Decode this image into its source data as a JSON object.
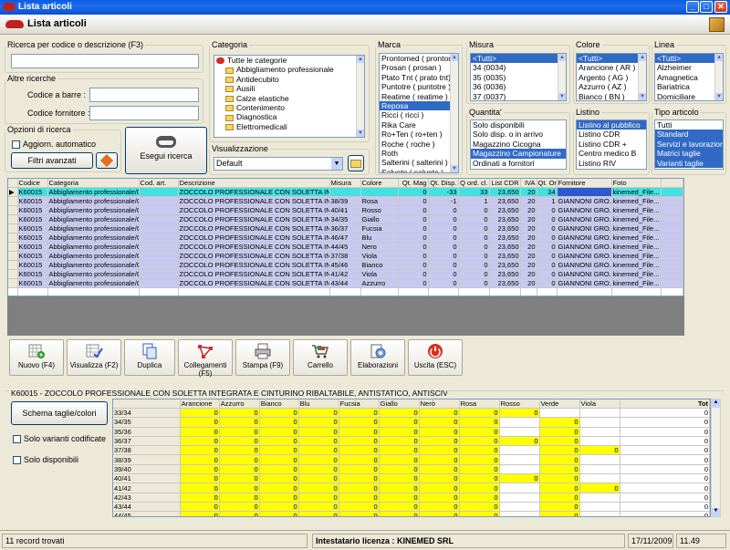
{
  "window": {
    "title": "Lista articoli",
    "header_title": "Lista articoli"
  },
  "search": {
    "legend": "Ricerca per codice o descrizione (F3)",
    "value": ""
  },
  "other_search": {
    "legend": "Altre ricerche",
    "barcode_label": "Codice a barre :",
    "supplier_code_label": "Codice fornitore :",
    "barcode_value": "",
    "supplier_code_value": ""
  },
  "options": {
    "legend": "Opzioni di ricerca",
    "auto_update_label": "Aggiorn. automatico",
    "advanced_filters_label": "Filtri avanzati",
    "execute_label": "Esegui ricerca"
  },
  "categoria": {
    "legend": "Categoria",
    "items": [
      "Tutte le categorie",
      "Abbigliamento professionale",
      "Antidecubito",
      "Ausili",
      "Calze elastiche",
      "Contenimento",
      "Diagnostica",
      "Elettromedicali"
    ]
  },
  "visualizzazione": {
    "legend": "Visualizzazione",
    "value": "Default"
  },
  "marca": {
    "legend": "Marca",
    "items": [
      "Prontomed ( prontom",
      "Prosan ( prosan )",
      "Ptato Tnt ( prato tnt)",
      "Puntotre ( puntotre )",
      "Reatime ( reatime )",
      "Reposa",
      "Ricci ( ricci )",
      "Rika Care",
      "Ro+Ten ( ro+ten )",
      "Roche ( roche )",
      "Roth",
      "Salterini ( salterini )",
      "Salvete ( salvete )"
    ],
    "selected": 5
  },
  "misura": {
    "legend": "Misura",
    "items": [
      "<Tutti>",
      "34 (0034)",
      "35 (0035)",
      "36 (0036)",
      "37 (0037)"
    ],
    "selected": 0
  },
  "quantita": {
    "legend": "Quantita'",
    "items": [
      "Solo disponibili",
      "Solo disp. o in arrivo",
      "Magazzino Cicogna",
      "Magazzino Campionature",
      "Ordinati a fornitori"
    ],
    "selected": 3
  },
  "colore": {
    "legend": "Colore",
    "items": [
      "<Tutti>",
      "Arancione ( AR )",
      "Argento ( AG )",
      "Azzurro ( AZ )",
      "Bianco ( BN )"
    ],
    "selected": 0
  },
  "listino": {
    "legend": "Listino",
    "items": [
      "Listino al pubblico",
      "Listino CDR",
      "Listino CDR +",
      "Centro medico B",
      "Listino RIV"
    ],
    "selected": 0
  },
  "linea": {
    "legend": "Linea",
    "items": [
      "<Tutti>",
      "Alzheimer",
      "Amagnetica",
      "Bariatrica",
      "Domiciliare"
    ],
    "selected": 0
  },
  "tipo_articolo": {
    "legend": "Tipo articolo",
    "items": [
      "Tutti",
      "Standard",
      "Servizi e lavorazioni",
      "Matrici taglie",
      "Varianti taglie"
    ],
    "selected": [
      1,
      2,
      3,
      4
    ]
  },
  "table": {
    "columns": [
      "Codice",
      "Categoria",
      "Cod. art.",
      "Descrizione",
      "Misura",
      "Colore",
      "Qt. Mag",
      "Qt. Disp.",
      "Q ord. cl.",
      "List CDR",
      "IVA",
      "Qt. Ord",
      "Fornitore",
      "Foto"
    ],
    "rows": [
      [
        "K60015",
        "Abbigliamento professionale/C...",
        "",
        "ZOCCOLO PROFESSIONALE CON SOLETTA INTE...",
        "",
        "",
        "0",
        "-33",
        "33",
        "23,650",
        "20",
        "34",
        "",
        "kinemed_File..."
      ],
      [
        "K60015",
        "Abbigliamento professionale/C...",
        "",
        "ZOCCOLO PROFESSIONALE CON SOLETTA INTE...",
        "38/39",
        "Rosa",
        "0",
        "-1",
        "1",
        "23,650",
        "20",
        "1",
        "GIANNONI GRO...",
        "kinemed_File..."
      ],
      [
        "K60015",
        "Abbigliamento professionale/C...",
        "",
        "ZOCCOLO PROFESSIONALE CON SOLETTA INTE...",
        "40/41",
        "Rosso",
        "0",
        "0",
        "0",
        "23,650",
        "20",
        "0",
        "GIANNONI GRO...",
        "kinemed_File..."
      ],
      [
        "K60015",
        "Abbigliamento professionale/C...",
        "",
        "ZOCCOLO PROFESSIONALE CON SOLETTA INTE...",
        "34/35",
        "Giallo",
        "0",
        "0",
        "0",
        "23,650",
        "20",
        "0",
        "GIANNONI GRO...",
        "kinemed_File..."
      ],
      [
        "K60015",
        "Abbigliamento professionale/C...",
        "",
        "ZOCCOLO PROFESSIONALE CON SOLETTA INTE...",
        "36/37",
        "Fucsia",
        "0",
        "0",
        "0",
        "23,650",
        "20",
        "0",
        "GIANNONI GRO...",
        "kinemed_File..."
      ],
      [
        "K60015",
        "Abbigliamento professionale/C...",
        "",
        "ZOCCOLO PROFESSIONALE CON SOLETTA INTE...",
        "46/47",
        "Blu",
        "0",
        "0",
        "0",
        "23,650",
        "20",
        "0",
        "GIANNONI GRO...",
        "kinemed_File..."
      ],
      [
        "K60015",
        "Abbigliamento professionale/C...",
        "",
        "ZOCCOLO PROFESSIONALE CON SOLETTA INTE...",
        "44/45",
        "Nero",
        "0",
        "0",
        "0",
        "23,650",
        "20",
        "0",
        "GIANNONI GRO...",
        "kinemed_File..."
      ],
      [
        "K60015",
        "Abbigliamento professionale/C...",
        "",
        "ZOCCOLO PROFESSIONALE CON SOLETTA INTE...",
        "37/38",
        "Viola",
        "0",
        "0",
        "0",
        "23,650",
        "20",
        "0",
        "GIANNONI GRO...",
        "kinemed_File..."
      ],
      [
        "K60015",
        "Abbigliamento professionale/C...",
        "",
        "ZOCCOLO PROFESSIONALE CON SOLETTA INTE...",
        "45/46",
        "Bianco",
        "0",
        "0",
        "0",
        "23,650",
        "20",
        "0",
        "GIANNONI GRO...",
        "kinemed_File..."
      ],
      [
        "K60015",
        "Abbigliamento professionale/C...",
        "",
        "ZOCCOLO PROFESSIONALE CON SOLETTA INTE...",
        "41/42",
        "Viola",
        "0",
        "0",
        "0",
        "23,650",
        "20",
        "0",
        "GIANNONI GRO...",
        "kinemed_File..."
      ],
      [
        "K60015",
        "Abbigliamento professionale/C...",
        "",
        "ZOCCOLO PROFESSIONALE CON SOLETTA INTE...",
        "43/44",
        "Azzurro",
        "0",
        "0",
        "0",
        "23,650",
        "20",
        "0",
        "GIANNONI GRO...",
        "kinemed_File..."
      ]
    ]
  },
  "toolbar": {
    "nuovo": "Nuovo (F4)",
    "visualizza": "Visualizza (F2)",
    "duplica": "Duplica",
    "collegamenti": "Collegamenti (F5)",
    "stampa": "Stampa (F9)",
    "carrello": "Carrello",
    "elaborazioni": "Elaborazioni",
    "uscita": "Uscita (ESC)"
  },
  "detail": {
    "title": "K60015 - ZOCCOLO PROFESSIONALE CON SOLETTA INTEGRATA E CINTURINO RIBALTABILE, ANTISTATICO, ANTISCIVOLO",
    "schema_button": "Schema taglie/colori",
    "solo_varianti": "Solo varianti codificate",
    "solo_disponibili": "Solo disponibili"
  },
  "size_grid": {
    "colors": [
      "Arancione",
      "Azzurro",
      "Bianco",
      "Blu",
      "Fucsia",
      "Giallo",
      "Nerò",
      "Rosa",
      "Rosso",
      "Verde",
      "Viola"
    ],
    "total_label": "Tot",
    "rows": [
      {
        "size": "33/34",
        "vals": [
          "0",
          "0",
          "0",
          "0",
          "0",
          "0",
          "0",
          "0",
          "0",
          "",
          ""
        ],
        "tot": "0"
      },
      {
        "size": "34/35",
        "vals": [
          "0",
          "0",
          "0",
          "0",
          "0",
          "0",
          "0",
          "0",
          "",
          "0",
          ""
        ],
        "tot": "0"
      },
      {
        "size": "35/36",
        "vals": [
          "0",
          "0",
          "0",
          "0",
          "0",
          "0",
          "0",
          "0",
          "",
          "0",
          ""
        ],
        "tot": "0"
      },
      {
        "size": "36/37",
        "vals": [
          "0",
          "0",
          "0",
          "0",
          "0",
          "0",
          "0",
          "0",
          "0",
          "0",
          ""
        ],
        "tot": "0"
      },
      {
        "size": "37/38",
        "vals": [
          "0",
          "0",
          "0",
          "0",
          "0",
          "0",
          "0",
          "0",
          "",
          "0",
          "0"
        ],
        "tot": "0"
      },
      {
        "size": "38/39",
        "vals": [
          "0",
          "0",
          "0",
          "0",
          "0",
          "0",
          "0",
          "0",
          "",
          "0",
          ""
        ],
        "tot": "0"
      },
      {
        "size": "39/40",
        "vals": [
          "0",
          "0",
          "0",
          "0",
          "0",
          "0",
          "0",
          "0",
          "",
          "0",
          ""
        ],
        "tot": "0"
      },
      {
        "size": "40/41",
        "vals": [
          "0",
          "0",
          "0",
          "0",
          "0",
          "0",
          "0",
          "0",
          "0",
          "0",
          ""
        ],
        "tot": "0"
      },
      {
        "size": "41/42",
        "vals": [
          "0",
          "0",
          "0",
          "0",
          "0",
          "0",
          "0",
          "0",
          "",
          "0",
          "0"
        ],
        "tot": "0"
      },
      {
        "size": "42/43",
        "vals": [
          "0",
          "0",
          "0",
          "0",
          "0",
          "0",
          "0",
          "0",
          "",
          "0",
          ""
        ],
        "tot": "0"
      },
      {
        "size": "43/44",
        "vals": [
          "0",
          "0",
          "0",
          "0",
          "0",
          "0",
          "0",
          "0",
          "",
          "0",
          ""
        ],
        "tot": "0"
      },
      {
        "size": "44/45",
        "vals": [
          "0",
          "0",
          "0",
          "0",
          "0",
          "0",
          "0",
          "0",
          "",
          "0",
          ""
        ],
        "tot": "0"
      }
    ]
  },
  "status": {
    "records": "11 record trovati",
    "license": "Intestatario licenza : KINEMED SRL",
    "date": "17/11/2009",
    "time": "11.49"
  },
  "colors": {
    "selected_row": "#c8c8f0",
    "current_row": "#43e0e0",
    "list_selection": "#316ac5",
    "size_cell": "#ffff00"
  }
}
